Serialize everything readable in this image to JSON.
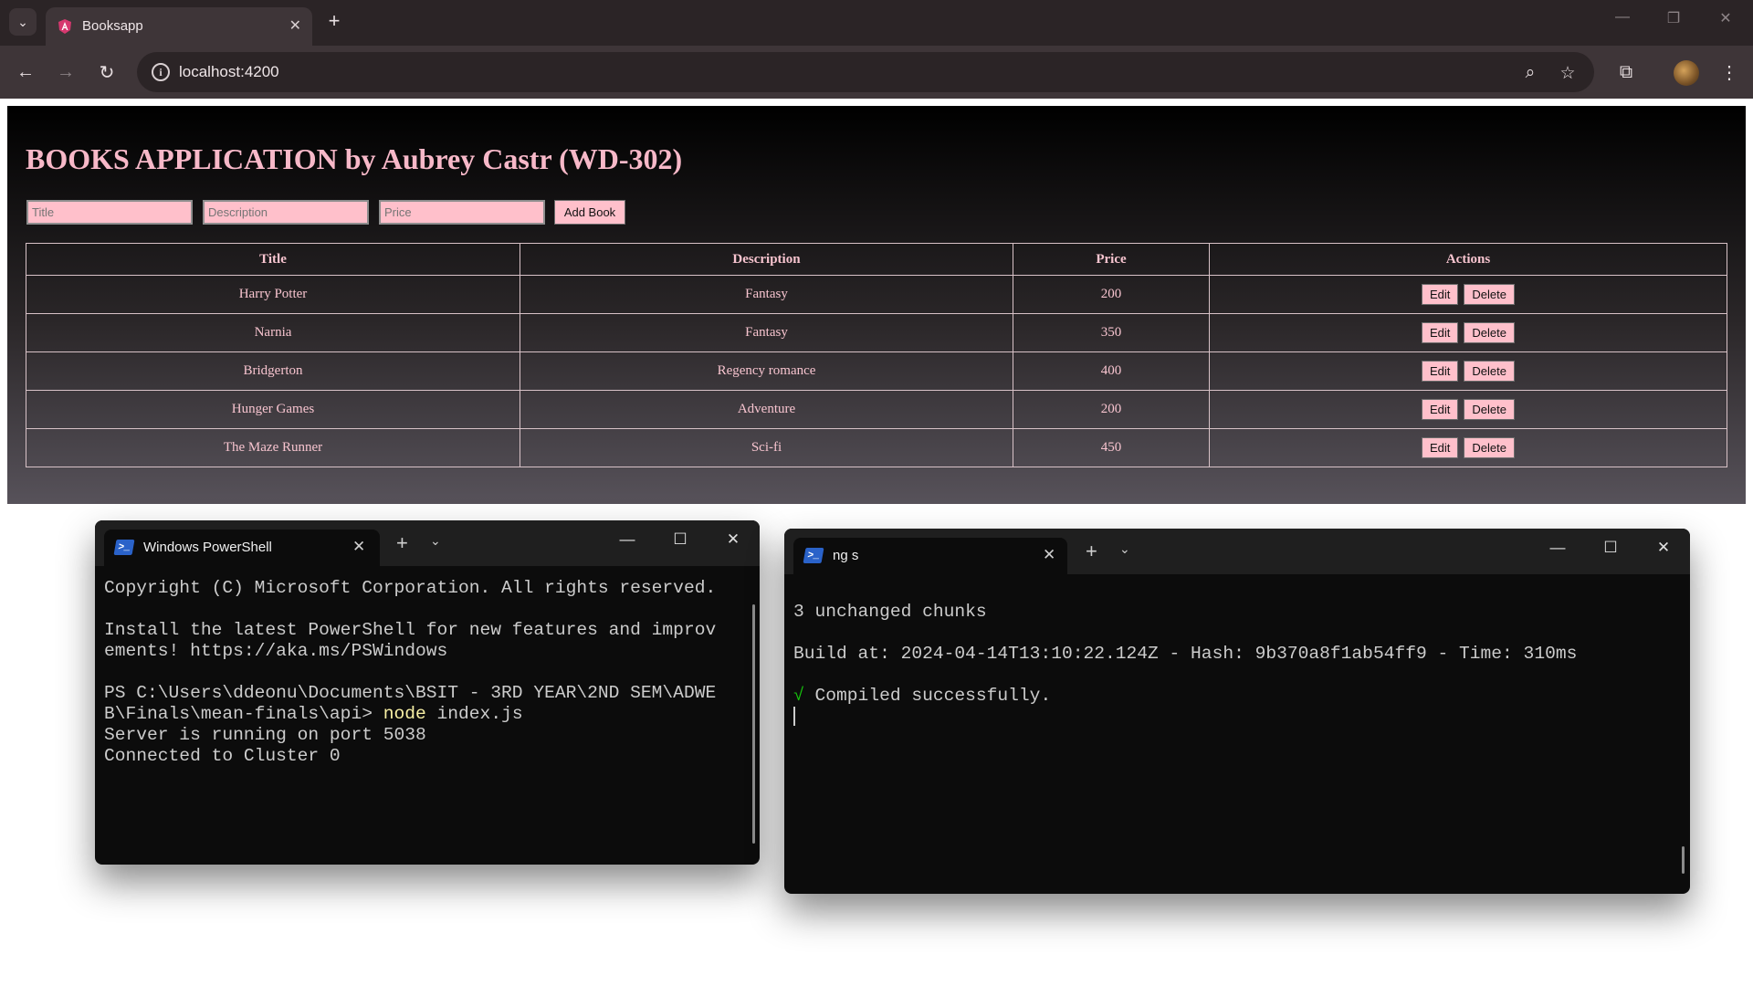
{
  "browser": {
    "tab_title": "Booksapp",
    "url": "localhost:4200",
    "tab_close": "✕",
    "new_tab": "+"
  },
  "app": {
    "heading": "BOOKS APPLICATION by Aubrey Castr (WD-302)",
    "form": {
      "title_placeholder": "Title",
      "description_placeholder": "Description",
      "price_placeholder": "Price",
      "add_button": "Add Book"
    },
    "table": {
      "headers": [
        "Title",
        "Description",
        "Price",
        "Actions"
      ],
      "rows": [
        {
          "title": "Harry Potter",
          "description": "Fantasy",
          "price": "200"
        },
        {
          "title": "Narnia",
          "description": "Fantasy",
          "price": "350"
        },
        {
          "title": "Bridgerton",
          "description": "Regency romance",
          "price": "400"
        },
        {
          "title": "Hunger Games",
          "description": "Adventure",
          "price": "200"
        },
        {
          "title": "The Maze Runner",
          "description": "Sci-fi",
          "price": "450"
        }
      ],
      "edit_label": "Edit",
      "delete_label": "Delete"
    }
  },
  "terminal_left": {
    "tab_title": "Windows PowerShell",
    "lines": {
      "copyright": "Copyright (C) Microsoft Corporation. All rights reserved.",
      "install_1": "Install the latest PowerShell for new features and improv",
      "install_2": "ements! https://aka.ms/PSWindows",
      "prompt_1": "PS C:\\Users\\ddeonu\\Documents\\BSIT - 3RD YEAR\\2ND SEM\\ADWE",
      "prompt_2": "B\\Finals\\mean-finals\\api> ",
      "command": "node",
      "command_arg": " index.js",
      "server": "Server is running on port 5038",
      "connected": "Connected to Cluster 0"
    }
  },
  "terminal_right": {
    "tab_title": "ng s",
    "lines": {
      "chunks": "3 unchanged chunks",
      "build": "Build at: 2024-04-14T13:10:22.124Z - Hash: 9b370a8f1ab54ff9 - Time: 310ms",
      "check": "√",
      "compiled": " Compiled successfully."
    }
  },
  "colors": {
    "accent_pink": "#ffc0cb",
    "heading_pink": "#f7b8c8",
    "terminal_green": "#16c60c",
    "terminal_yellow": "#f9f1a5"
  }
}
